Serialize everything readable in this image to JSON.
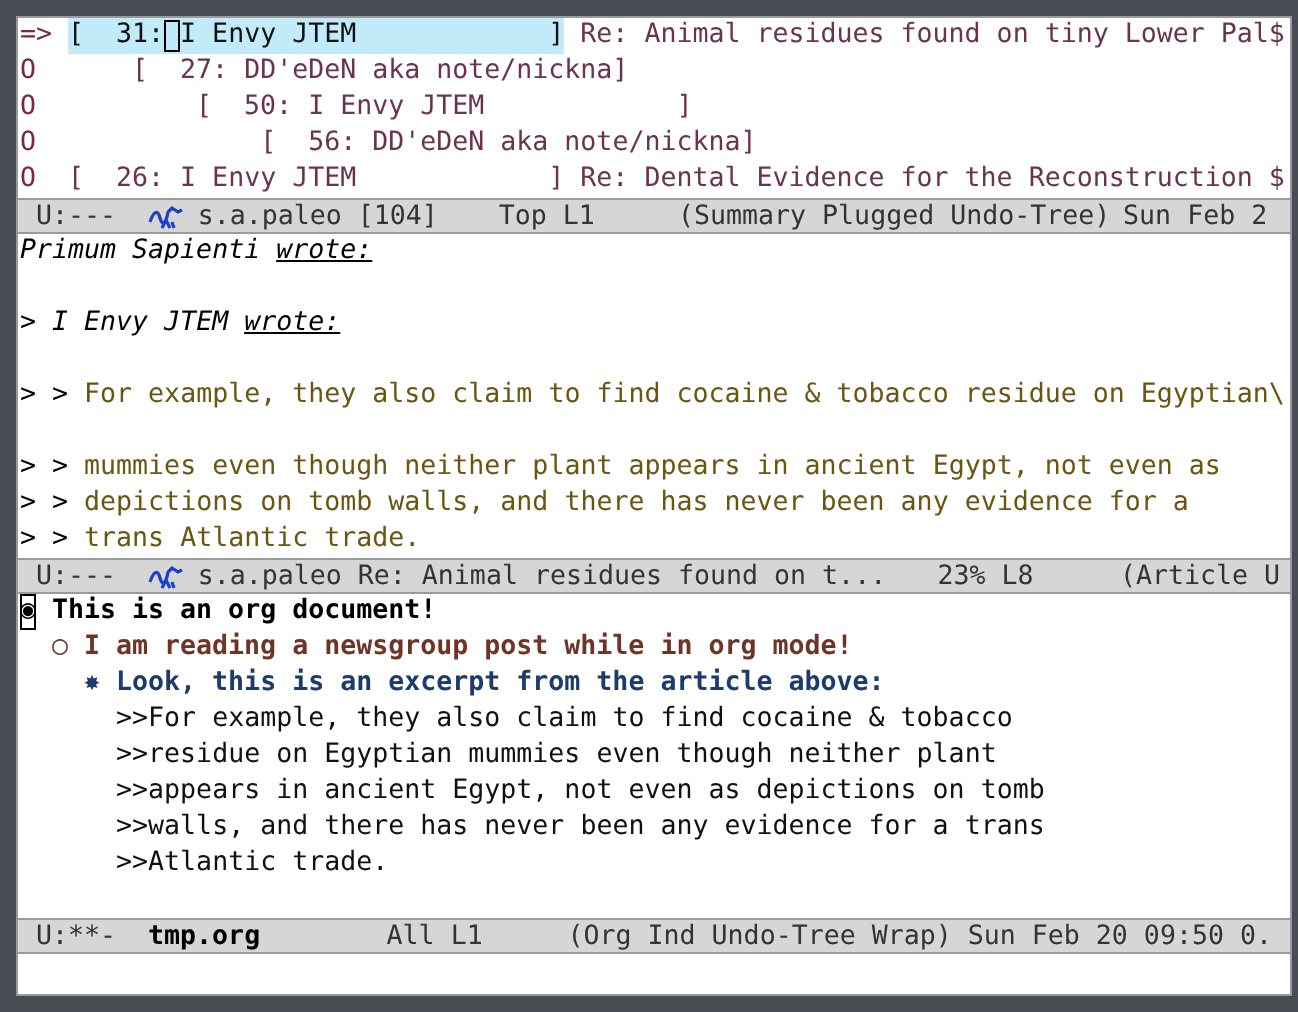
{
  "summary": {
    "threads": [
      {
        "mark": "=>",
        "open": "[",
        "number": "31:",
        "close": "]",
        "author": "I Envy JTEM",
        "subject": "Re: Animal residues found on tiny Lower Pal$",
        "selected": true,
        "children": [
          {
            "mark": "O",
            "open": "[",
            "number": "27:",
            "close": "]",
            "author": "DD'eDeN aka note/nickna",
            "selected": false,
            "children": [
              {
                "mark": "O",
                "open": "[",
                "number": "50:",
                "close": "]",
                "author": "I Envy JTEM",
                "selected": false,
                "children": [
                  {
                    "mark": "O",
                    "open": "[",
                    "number": "56:",
                    "close": "]",
                    "author": "DD'eDeN aka note/nickna",
                    "selected": false
                  }
                ]
              }
            ]
          }
        ]
      },
      {
        "mark": "O",
        "open": "[",
        "number": "26:",
        "close": "]",
        "author": "I Envy JTEM",
        "subject": "Re: Dental Evidence for the Reconstruction $",
        "selected": false
      }
    ]
  },
  "summary_mode_line": {
    "state": "U:---",
    "icon": true,
    "buffer": "s.a.paleo [104]",
    "position": "Top L1",
    "modes": "(Summary Plugged Undo-Tree)",
    "clock": "Sun Feb 2"
  },
  "article": {
    "lines": [
      {
        "kind": "attribution",
        "name": "Primum Sapienti",
        "verb": "wrote:"
      },
      {
        "kind": "blank"
      },
      {
        "kind": "attribution",
        "prefix": ">",
        "name": "I Envy JTEM",
        "verb": "wrote:"
      },
      {
        "kind": "blank"
      },
      {
        "kind": "quote",
        "prefix": "> >",
        "text": "For example, they also claim to find cocaine & tobacco residue on Egyptian\\"
      },
      {
        "kind": "blank"
      },
      {
        "kind": "quote",
        "prefix": "> >",
        "text": "mummies even though neither plant appears in ancient Egypt, not even as"
      },
      {
        "kind": "quote",
        "prefix": "> >",
        "text": "depictions on tomb walls, and there has never been any evidence for a"
      },
      {
        "kind": "quote",
        "prefix": "> >",
        "text": "trans Atlantic trade."
      }
    ]
  },
  "article_mode_line": {
    "state": "U:---",
    "icon": true,
    "buffer": "s.a.paleo Re: Animal residues found on t...",
    "position": "23% L8",
    "modes": "(Article U"
  },
  "org": {
    "headings": [
      {
        "bullet": "◉",
        "title": "This is an org document!",
        "cursor": true,
        "children": [
          {
            "bullet": "○",
            "title": "I am reading a newsgroup post while in org mode!",
            "cursor": false,
            "children": [
              {
                "bullet": "✸",
                "title": "Look, this is an excerpt from the article above:",
                "cursor": false,
                "body": [
                  ">>For example, they also claim to find cocaine & tobacco",
                  ">>residue on Egyptian mummies even though neither plant",
                  ">>appears in ancient Egypt, not even as depictions on tomb",
                  ">>walls, and there has never been any evidence for a trans",
                  ">>Atlantic trade."
                ]
              }
            ]
          }
        ]
      }
    ]
  },
  "org_mode_line": {
    "state": "U:**-",
    "icon": false,
    "buffer": "tmp.org",
    "position": "All L1",
    "modes": "(Org Ind Undo-Tree Wrap)",
    "clock": "Sun Feb 20 09:50 0."
  }
}
